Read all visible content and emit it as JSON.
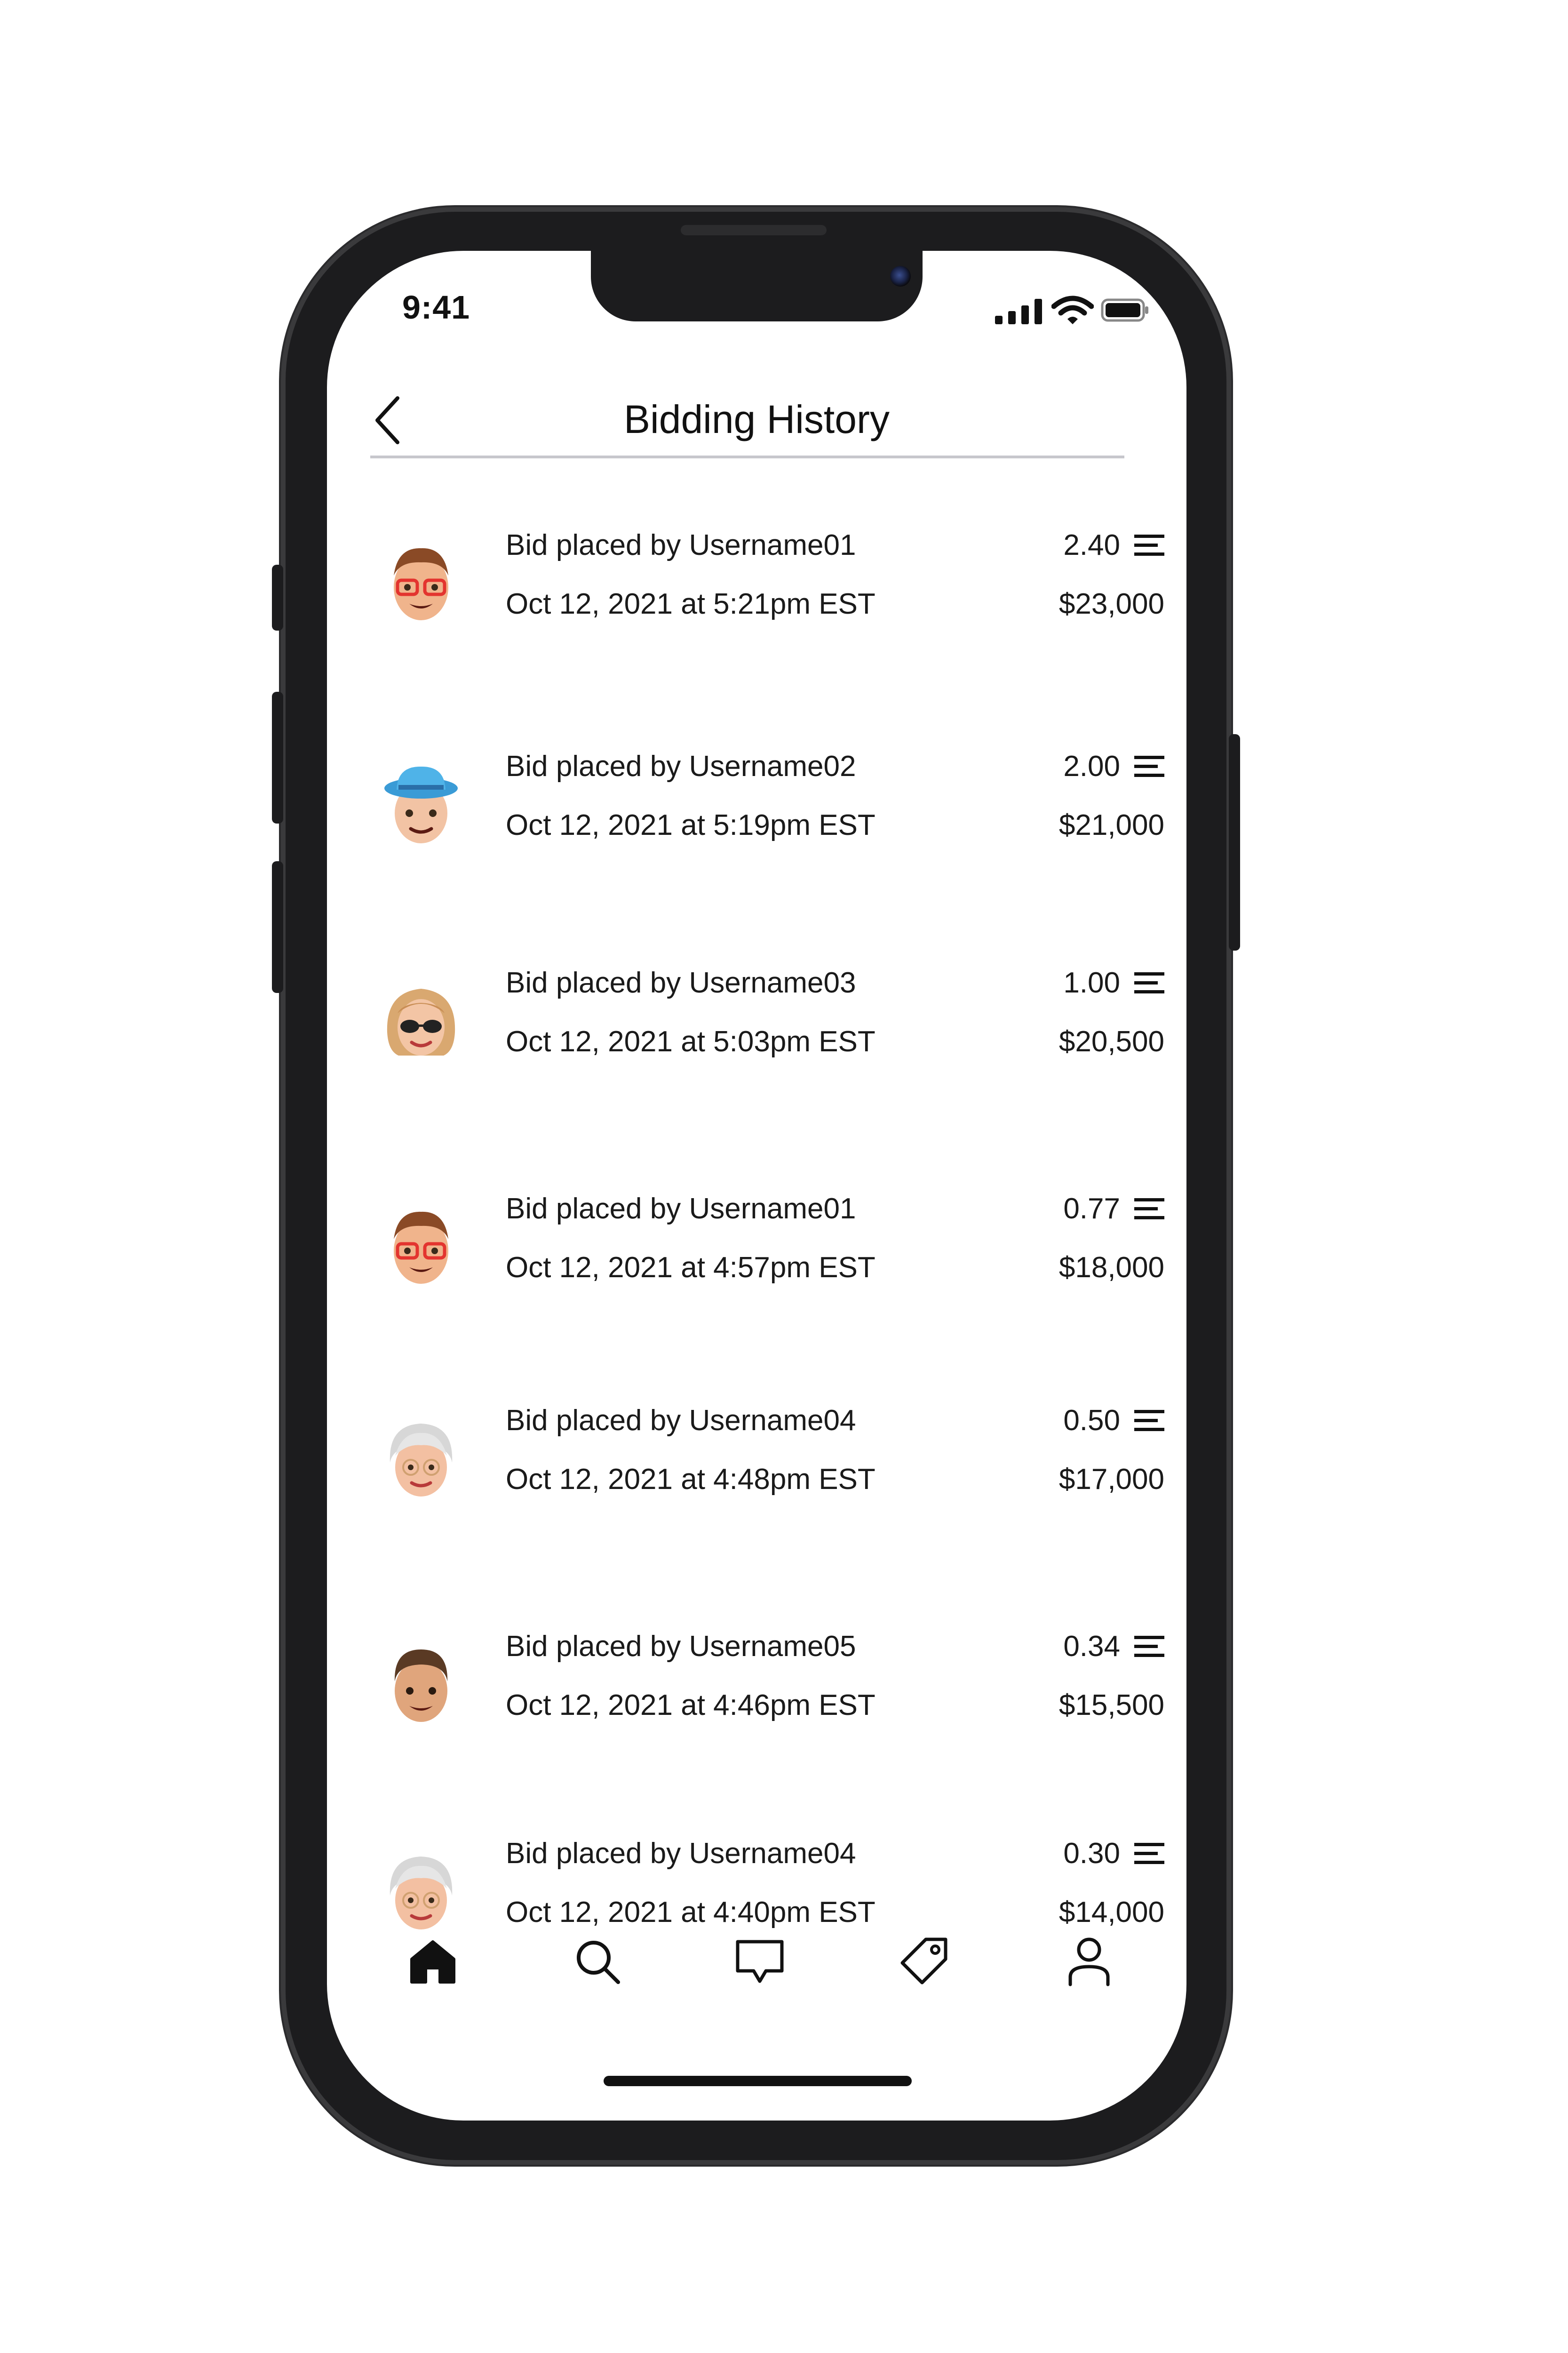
{
  "status_bar": {
    "time": "9:41",
    "icons": [
      "signal-icon",
      "wifi-icon",
      "battery-icon"
    ]
  },
  "header": {
    "back_icon": "chevron-left-icon",
    "title": "Bidding History"
  },
  "bids": [
    {
      "user": "Bid placed by Username01",
      "date": "Oct 12, 2021 at 5:21pm EST",
      "rate": "2.40",
      "amount": "$23,000",
      "avatar": "avatar-01"
    },
    {
      "user": "Bid placed by Username02",
      "date": "Oct 12, 2021 at 5:19pm EST",
      "rate": "2.00",
      "amount": "$21,000",
      "avatar": "avatar-02"
    },
    {
      "user": "Bid placed by Username03",
      "date": "Oct 12, 2021 at 5:03pm EST",
      "rate": "1.00",
      "amount": "$20,500",
      "avatar": "avatar-03"
    },
    {
      "user": "Bid placed by Username01",
      "date": "Oct 12, 2021 at 4:57pm EST",
      "rate": "0.77",
      "amount": "$18,000",
      "avatar": "avatar-01"
    },
    {
      "user": "Bid placed by Username04",
      "date": "Oct 12, 2021 at 4:48pm EST",
      "rate": "0.50",
      "amount": "$17,000",
      "avatar": "avatar-04"
    },
    {
      "user": "Bid placed by Username05",
      "date": "Oct 12, 2021 at 4:46pm EST",
      "rate": "0.34",
      "amount": "$15,500",
      "avatar": "avatar-05"
    },
    {
      "user": "Bid placed by Username04",
      "date": "Oct 12, 2021 at 4:40pm EST",
      "rate": "0.30",
      "amount": "$14,000",
      "avatar": "avatar-04"
    }
  ],
  "tab_bar": {
    "tabs": [
      "home-icon",
      "search-icon",
      "chat-icon",
      "tag-icon",
      "profile-icon"
    ],
    "active": "home-icon"
  },
  "colors": {
    "text": "#1a1a1a",
    "divider": "#c7c7cc",
    "phone_frame": "#1c1c1e"
  }
}
